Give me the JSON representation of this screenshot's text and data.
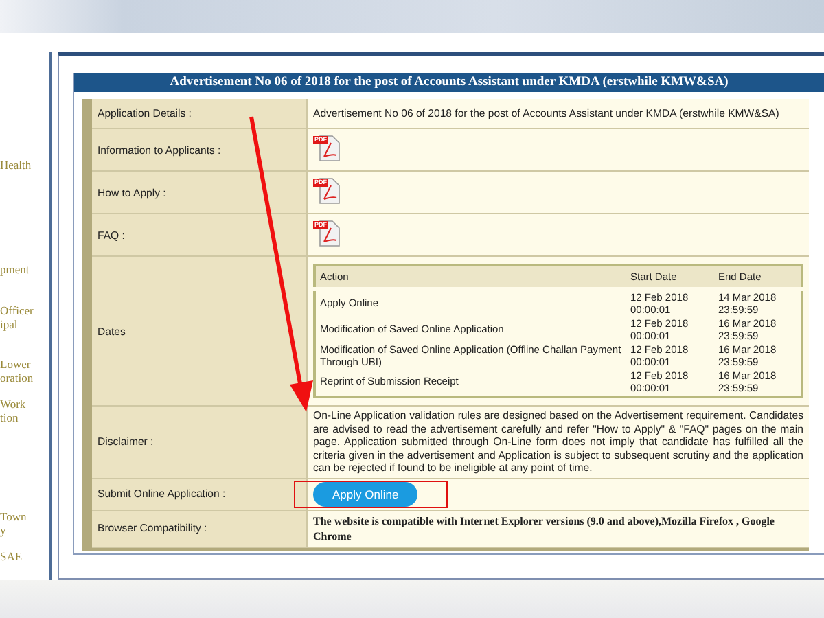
{
  "sidebar": {
    "items": [
      {
        "lines": [
          "Health"
        ]
      },
      {
        "lines": [
          "pment"
        ]
      },
      {
        "lines": [
          "Officer",
          "ipal"
        ]
      },
      {
        "lines": [
          "Lower",
          "oration"
        ]
      },
      {
        "lines": [
          "Work",
          "tion"
        ]
      },
      {
        "lines": [
          "Town",
          "y"
        ]
      },
      {
        "lines": [
          "SAE"
        ]
      }
    ]
  },
  "title": "Advertisement No 06 of 2018 for the post of Accounts Assistant under KMDA (erstwhile KMW&SA)",
  "rows": [
    {
      "label": "Application Details :",
      "kind": "text",
      "value": "Advertisement No 06 of 2018 for the post of Accounts Assistant under KMDA (erstwhile KMW&SA)"
    },
    {
      "label": "Information to Applicants :",
      "kind": "pdf",
      "value": "PDF"
    },
    {
      "label": "How to Apply :",
      "kind": "pdf",
      "value": "PDF"
    },
    {
      "label": "FAQ :",
      "kind": "pdf",
      "value": "PDF"
    },
    {
      "label": "Dates",
      "kind": "dates"
    },
    {
      "label": "Disclaimer :",
      "kind": "text",
      "value": "On-Line Application validation rules are designed based on the Advertisement requirement. Candidates are advised to read the advertisement carefully and refer \"How to Apply\" & \"FAQ\" pages on the main page. Application submitted through On-Line form does not imply that candidate has fulfilled all the criteria given in the advertisement and Application is subject to subsequent scrutiny and the application can be rejected if found to be ineligible at any point of time."
    },
    {
      "label": "Submit Online Application :",
      "kind": "button",
      "value": "Apply Online"
    },
    {
      "label": "Browser Compatibility :",
      "kind": "bold",
      "value": "The website is compatible with Internet Explorer versions (9.0 and above),Mozilla Firefox , Google Chrome"
    }
  ],
  "dates": {
    "columns": [
      "Action",
      "Start Date",
      "End Date"
    ],
    "rows": [
      [
        "Apply Online",
        "12 Feb 2018 00:00:01",
        "14 Mar 2018 23:59:59"
      ],
      [
        "Modification of Saved Online Application",
        "12 Feb 2018 00:00:01",
        "16 Mar 2018 23:59:59"
      ],
      [
        "Modification of Saved Online Application (Offline Challan Payment Through UBI)",
        "12 Feb 2018 00:00:01",
        "16 Mar 2018 23:59:59"
      ],
      [
        "Reprint of Submission Receipt",
        "12 Feb 2018 00:00:01",
        "16 Mar 2018 23:59:59"
      ]
    ]
  }
}
